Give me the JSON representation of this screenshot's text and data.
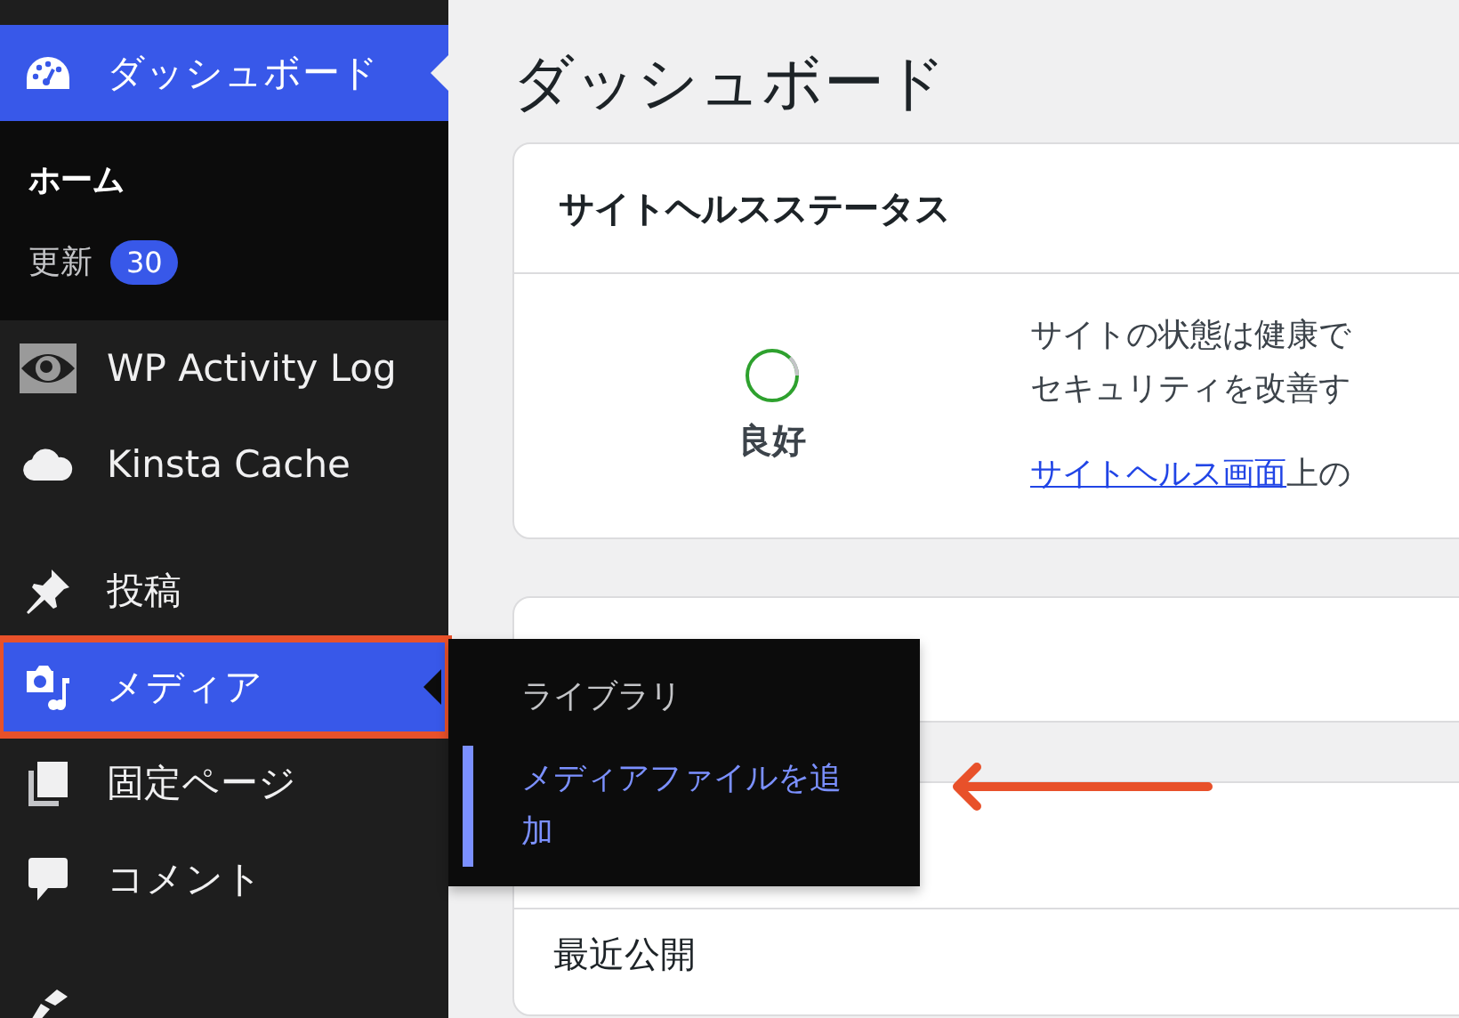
{
  "sidebar": {
    "menu": [
      {
        "label": "ダッシュボード",
        "kind": "gauge",
        "highlighted": true,
        "annotated": false,
        "separator_before": false,
        "children": [
          {
            "label": "ホーム",
            "selected": true
          },
          {
            "label": "更新",
            "selected": false,
            "badge": "30"
          }
        ]
      },
      {
        "label": "WP Activity Log",
        "kind": "eye",
        "highlighted": false,
        "annotated": false,
        "separator_before": false
      },
      {
        "label": "Kinsta Cache",
        "kind": "cloud",
        "highlighted": false,
        "annotated": false,
        "separator_before": false
      },
      {
        "label": "投稿",
        "kind": "pin",
        "highlighted": false,
        "annotated": false,
        "separator_before": true
      },
      {
        "label": "メディア",
        "kind": "media",
        "highlighted": true,
        "annotated": true,
        "separator_before": false
      },
      {
        "label": "固定ページ",
        "kind": "pages",
        "highlighted": false,
        "annotated": false,
        "separator_before": false
      },
      {
        "label": "コメント",
        "kind": "comment",
        "highlighted": false,
        "annotated": false,
        "separator_before": false
      },
      {
        "kind": "brush",
        "highlighted": false,
        "annotated": false,
        "separator_before": true
      }
    ]
  },
  "flyout_menu": {
    "items": [
      {
        "label": "ライブラリ",
        "selected": false
      },
      {
        "label": "メディアファイルを追加",
        "selected": true
      }
    ]
  },
  "page_title": "ダッシュボード",
  "site_health": {
    "title": "サイトヘルスステータス",
    "status_label": "良好",
    "description_lines": [
      "サイトの状態は健康で",
      "セキュリティを改善す"
    ],
    "link": "サイトヘルス画面",
    "link_suffix": "上の"
  },
  "activity_card": {
    "section_label": "最近公開"
  }
}
